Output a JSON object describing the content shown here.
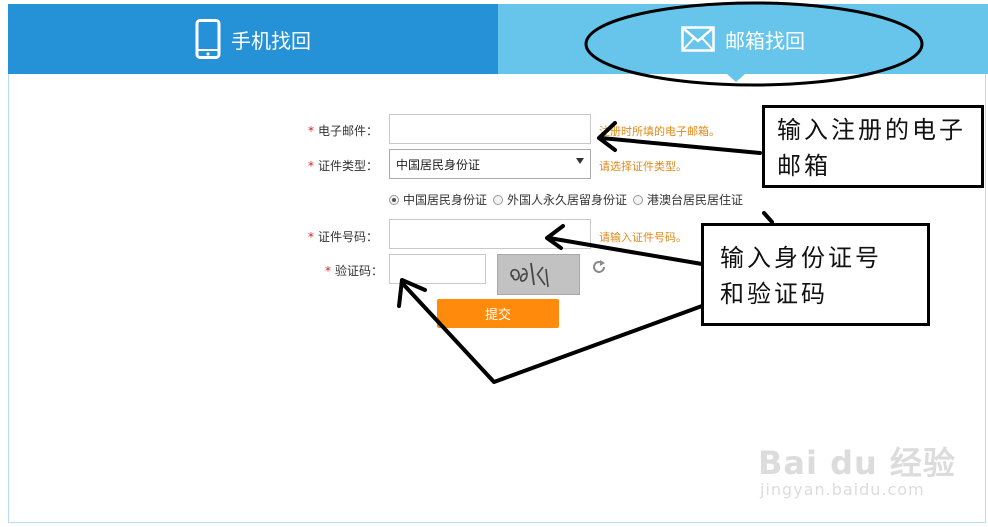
{
  "tabs": {
    "phone_label": "手机找回",
    "email_label": "邮箱找回"
  },
  "form": {
    "email": {
      "label": "电子邮件：",
      "hint": "注册时所填的电子邮箱。",
      "value": ""
    },
    "id_type": {
      "label": "证件类型：",
      "selected": "中国居民身份证",
      "hint": "请选择证件类型。"
    },
    "id_type_options": [
      "中国居民身份证",
      "外国人永久居留身份证",
      "港澳台居民居住证"
    ],
    "id_type_checked_index": 0,
    "id_number": {
      "label": "证件号码：",
      "hint": "请输入证件号码。",
      "value": ""
    },
    "captcha": {
      "label": "验证码：",
      "value": ""
    },
    "submit_label": "提交",
    "required_mark": "*"
  },
  "annotations": {
    "email_note": {
      "line1": "输入注册的电子",
      "line2": "邮箱"
    },
    "id_note": {
      "line1": "输入身份证号",
      "line2": "和验证码"
    }
  },
  "colors": {
    "tab_active": "#2591d6",
    "tab_inactive": "#67c4ea",
    "accent_orange": "#ff8a0b",
    "hint_orange": "#e08a1a",
    "required_red": "#e02020"
  },
  "watermark": {
    "logo_text": "Bai du 经验",
    "url": "jingyan.baidu.com"
  }
}
